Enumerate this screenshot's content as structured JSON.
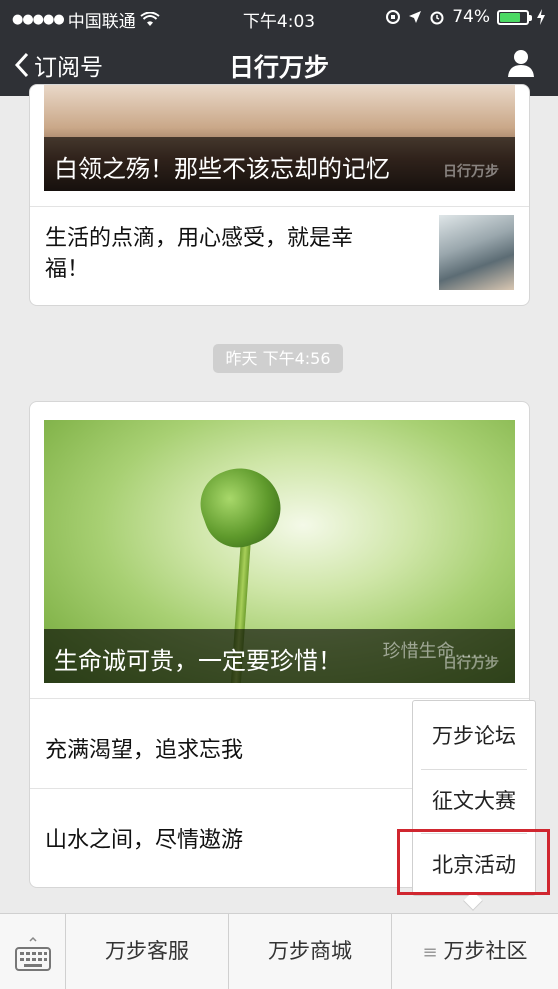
{
  "status_bar": {
    "carrier": "中国联通",
    "time": "下午4:03",
    "battery": "74%"
  },
  "nav": {
    "back_label": "订阅号",
    "title": "日行万步"
  },
  "card1": {
    "hero_caption": "白领之殇！那些不该忘却的记忆",
    "watermark": "日行万步",
    "article_text": "生活的点滴，用心感受，就是幸福！"
  },
  "timestamp": "昨天 下午4:56",
  "card2": {
    "hero_caption": "生命诚可贵，一定要珍惜！",
    "hero_overlay_text": "珍惜生命......",
    "watermark": "日行万步",
    "article_1": "充满渴望，追求忘我",
    "article_2": "山水之间，尽情遨游"
  },
  "popup_menu": {
    "items": [
      "万步论坛",
      "征文大赛",
      "北京活动"
    ]
  },
  "bottom_menu": {
    "tabs": [
      "万步客服",
      "万步商城",
      "万步社区"
    ]
  },
  "colors": {
    "nav_bg": "#2f3136",
    "highlight": "#d0262f",
    "battery": "#4cd964"
  }
}
